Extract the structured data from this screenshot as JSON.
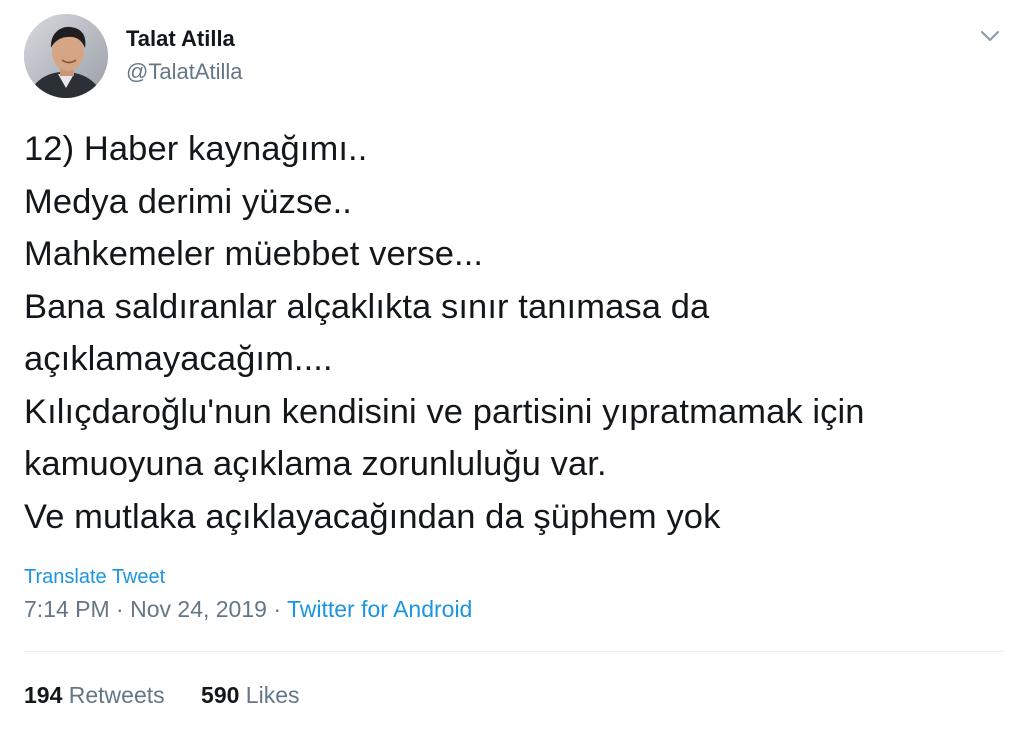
{
  "author": {
    "name": "Talat Atilla",
    "handle": "@TalatAtilla",
    "avatar_icon": "profile-photo"
  },
  "menu": {
    "caret_icon": "chevron-down-icon"
  },
  "tweet": {
    "lines": [
      "12) Haber kaynağımı..",
      "Medya derimi yüzse..",
      "Mahkemeler müebbet verse...",
      "Bana saldıranlar alçaklıkta sınır tanımasa da",
      "açıklamayacağım....",
      "Kılıçdaroğlu'nun kendisini ve partisini yıpratmamak için",
      "kamuoyuna açıklama zorunluluğu var.",
      "Ve mutlaka açıklayacağından da şüphem yok"
    ],
    "translate_label": "Translate Tweet",
    "time": "7:14 PM",
    "separator": "·",
    "date": "Nov 24, 2019",
    "source": "Twitter for Android"
  },
  "stats": {
    "retweets_count": "194",
    "retweets_label": "Retweets",
    "likes_count": "590",
    "likes_label": "Likes"
  },
  "colors": {
    "text": "#14171a",
    "secondary": "#657786",
    "link": "#1b95e0",
    "divider": "#e6ecf0"
  }
}
